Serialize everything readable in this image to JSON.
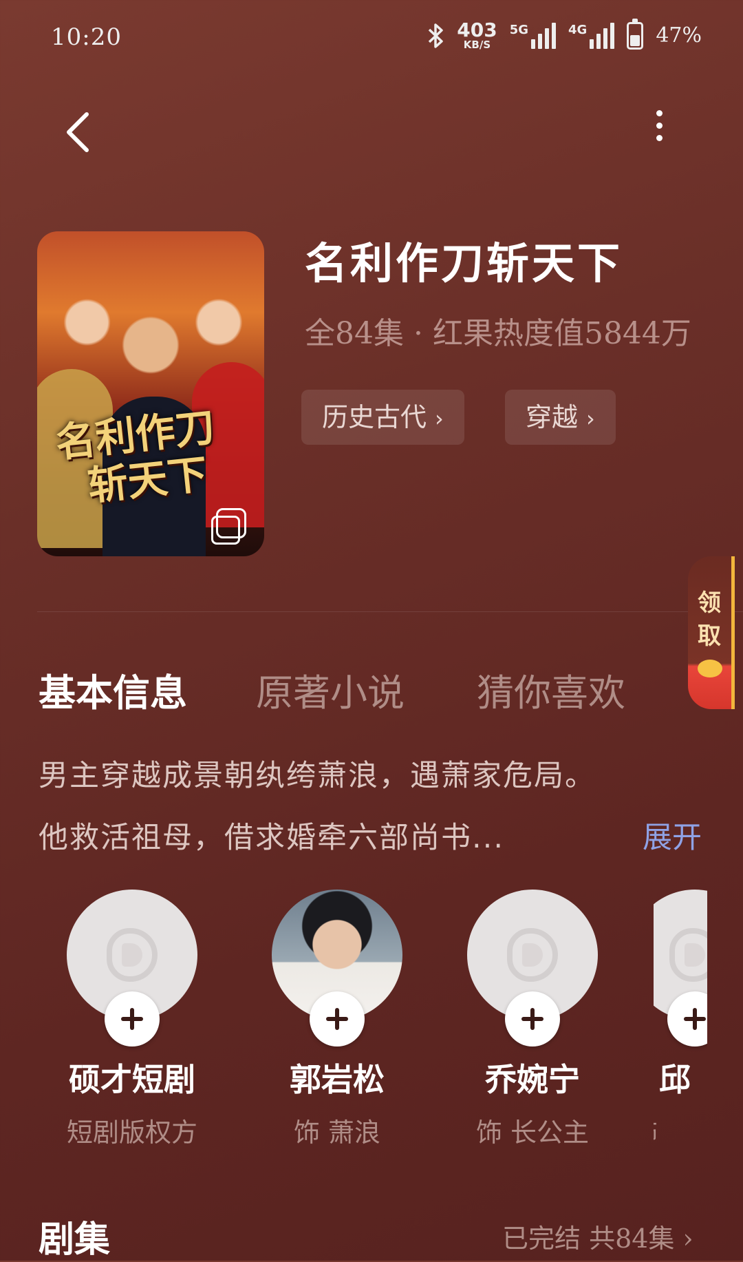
{
  "status_bar": {
    "time": "10:20",
    "speed_value": "403",
    "speed_unit": "KB/S",
    "net1": "5G",
    "net2": "4G",
    "battery": "47%"
  },
  "nav": {
    "back_icon": "chevron-left-icon",
    "more_icon": "more-vertical-icon"
  },
  "drama": {
    "poster_title_line1": "名利作刀",
    "poster_title_line2": "斩天下",
    "title": "名利作刀斩天下",
    "meta": "全84集 · 红果热度值5844万",
    "tags": [
      {
        "label": "历史古代",
        "chevron": "›"
      },
      {
        "label": "穿越",
        "chevron": "›"
      }
    ]
  },
  "side_widget": {
    "line1": "领",
    "line2": "取"
  },
  "tabs": [
    {
      "label": "基本信息",
      "active": true
    },
    {
      "label": "原著小说",
      "active": false
    },
    {
      "label": "猜你喜欢",
      "active": false
    }
  ],
  "synopsis": {
    "line1": "男主穿越成景朝纨绔萧浪，遇萧家危局。",
    "line2": "他救活祖母，借求婚牵六部尚书...",
    "expand": "展开"
  },
  "cast": [
    {
      "name": "硕才短剧",
      "role": "短剧版权方"
    },
    {
      "name": "郭岩松",
      "role": "饰 萧浪"
    },
    {
      "name": "乔婉宁",
      "role": "饰 长公主"
    },
    {
      "name": "邱",
      "role": "饰"
    }
  ],
  "episodes": {
    "title": "剧集",
    "status": "已完结 共84集 ›"
  },
  "colors": {
    "background": "#6a2f28",
    "accent_link": "#8fa2e6",
    "widget_gold": "#f2b63c"
  }
}
